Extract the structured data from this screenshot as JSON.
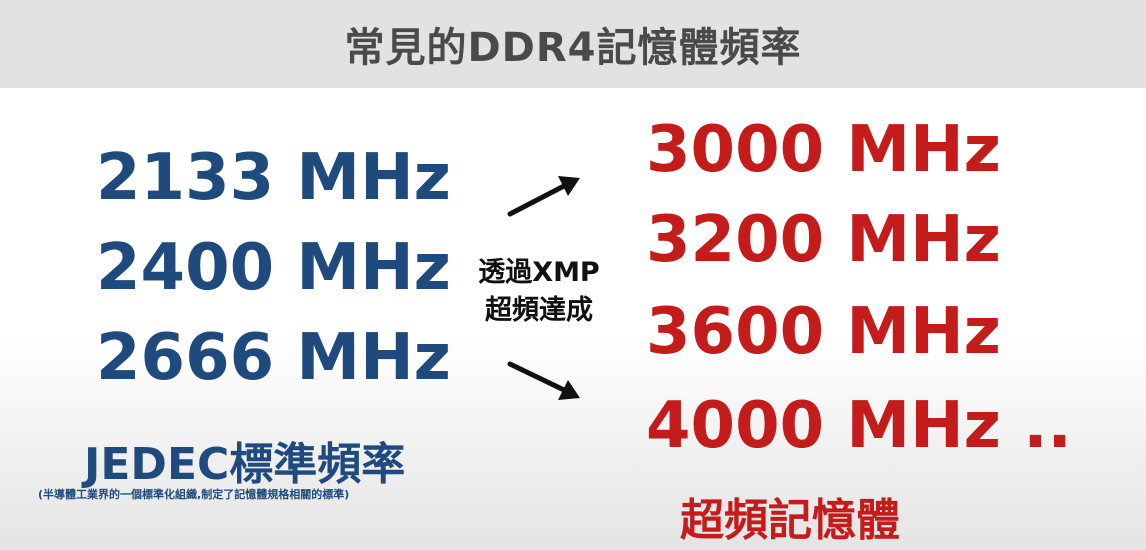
{
  "title": "常見的DDR4記憶體頻率",
  "jedec": {
    "frequencies": [
      "2133 MHz",
      "2400 MHz",
      "2666 MHz"
    ],
    "label": "JEDEC標準頻率",
    "note": "(半導體工業界的一個標準化組織,制定了記憶體規格相關的標準)"
  },
  "xmp": {
    "line1": "透過XMP",
    "line2": "超頻達成"
  },
  "overclock": {
    "frequencies": [
      "3000 MHz",
      "3200 MHz",
      "3600 MHz",
      "4000 MHz .."
    ],
    "label": "超頻記憶體"
  },
  "colors": {
    "jedec_blue": "#1e4a7d",
    "overclock_red": "#c41b1b",
    "header_bg": "#e2e2e2",
    "title_gray": "#4a4a4a"
  },
  "icons": {
    "arrow_up": "arrow-up-right-icon",
    "arrow_down": "arrow-down-right-icon"
  }
}
